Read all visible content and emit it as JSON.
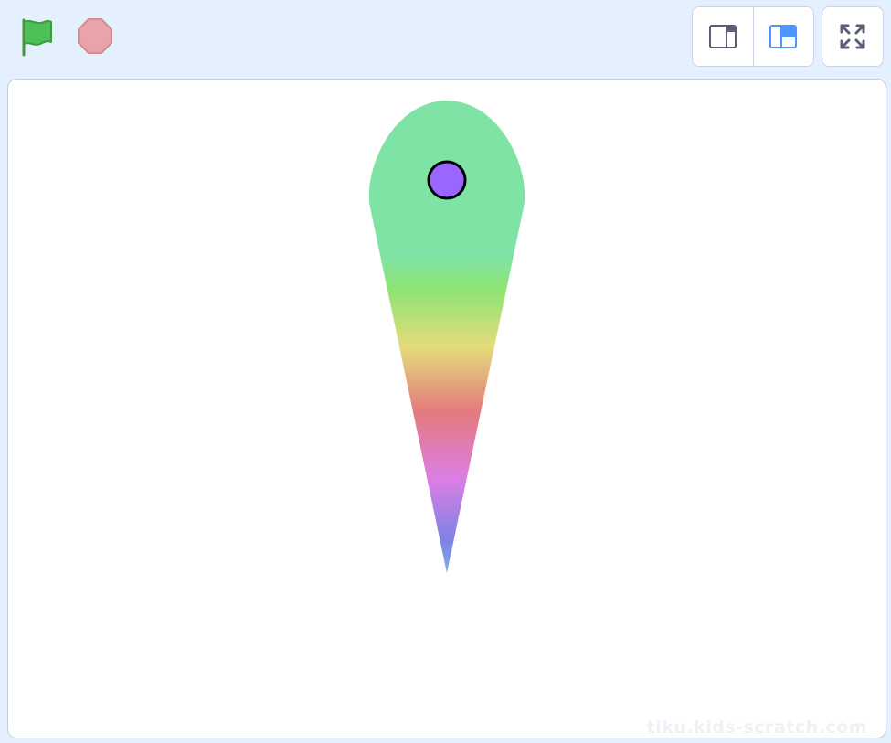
{
  "toolbar": {
    "green_flag": {
      "icon": "green-flag-icon",
      "color": "#4cbf56",
      "stroke": "#45993d"
    },
    "stop": {
      "icon": "stop-sign-icon",
      "color": "#e9a3ab",
      "stroke": "#d38b94"
    },
    "stage_modes": [
      {
        "icon": "small-stage-icon",
        "active": false,
        "color": "#575e75"
      },
      {
        "icon": "large-stage-icon",
        "active": true,
        "color": "#4c97ff"
      }
    ],
    "fullscreen": {
      "icon": "fullscreen-icon",
      "color": "#575e75"
    }
  },
  "stage": {
    "background": "#ffffff",
    "drawing": {
      "shape": "rainbow-teardrop",
      "colors": [
        "#80e3a6",
        "#8ee474",
        "#e4dc7a",
        "#e47a7e",
        "#dc7ee4",
        "#7e82e4"
      ]
    },
    "sprite": {
      "icon": "purple-ball-sprite",
      "fill": "#9966ff",
      "stroke": "#000000"
    },
    "watermark": "tiku.kids-scratch.com"
  }
}
